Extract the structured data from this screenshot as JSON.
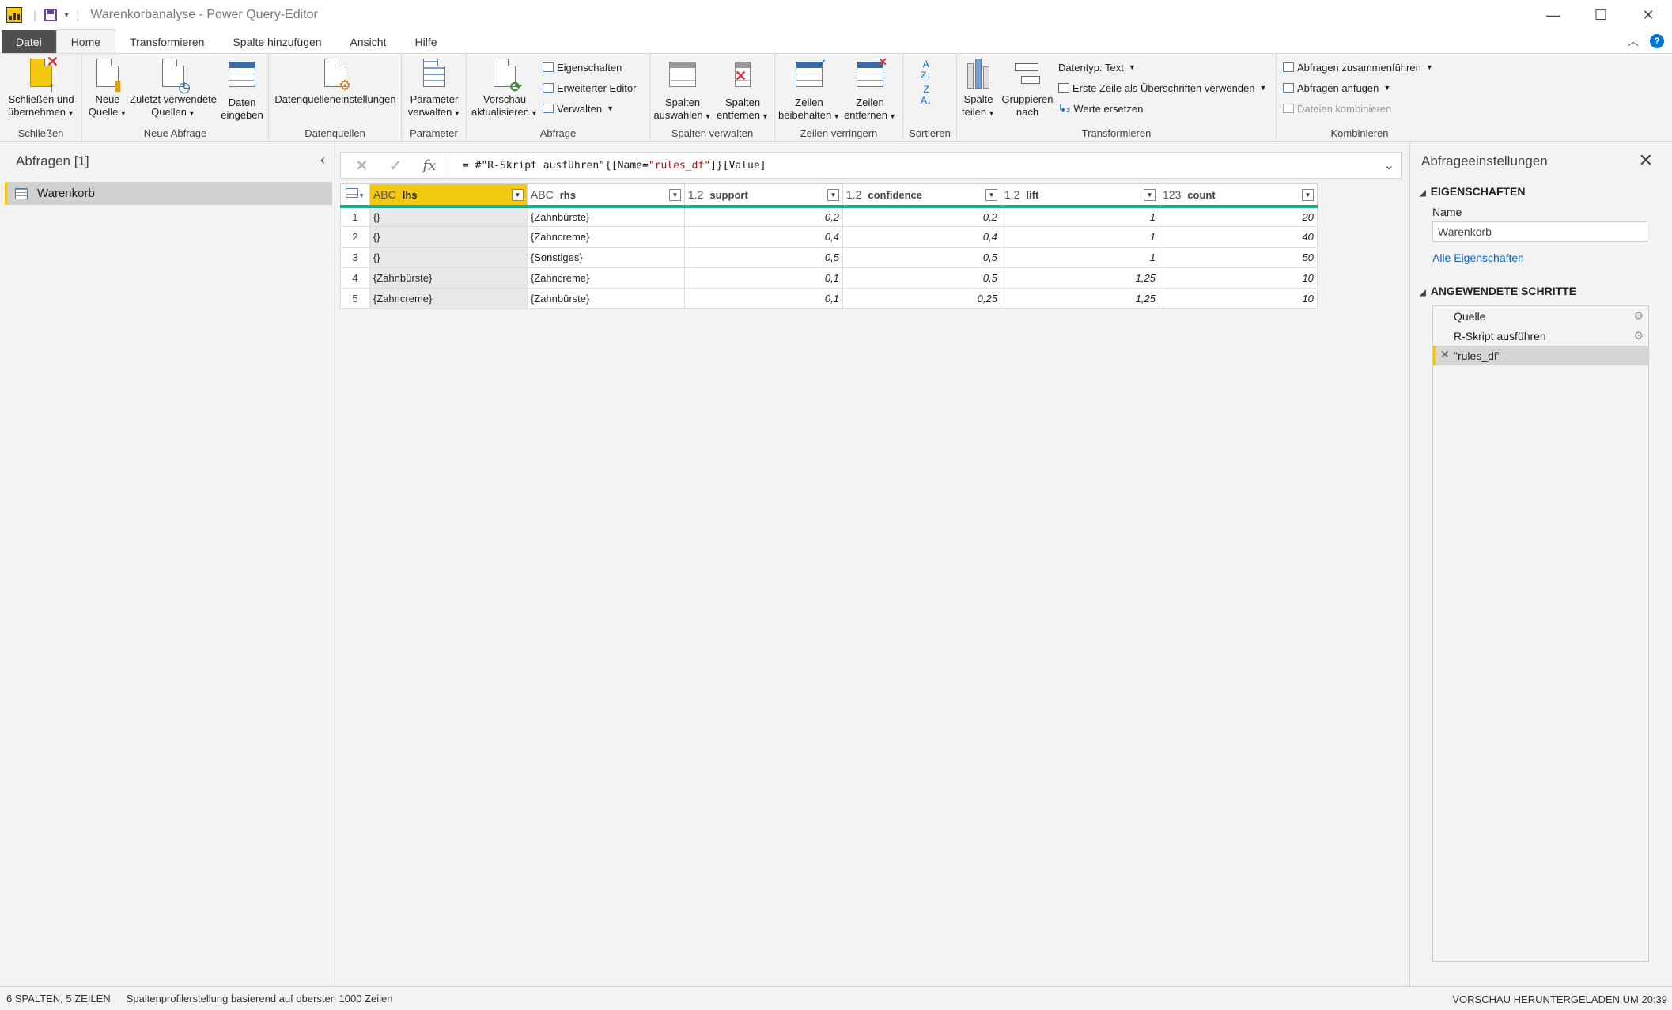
{
  "window": {
    "title": "Warenkorbanalyse - Power Query-Editor",
    "controls": {
      "minimize": "—",
      "maximize": "☐",
      "close": "✕"
    }
  },
  "tabs": [
    {
      "label": "Datei"
    },
    {
      "label": "Home"
    },
    {
      "label": "Transformieren"
    },
    {
      "label": "Spalte hinzufügen"
    },
    {
      "label": "Ansicht"
    },
    {
      "label": "Hilfe"
    }
  ],
  "help_label": "?",
  "ribbon": {
    "schliessen": {
      "btn1": "Schließen und",
      "btn2": "übernehmen",
      "group": "Schließen"
    },
    "neue_abfrage": {
      "neue_quelle_1": "Neue",
      "neue_quelle_2": "Quelle",
      "zuletzt_1": "Zuletzt verwendete",
      "zuletzt_2": "Quellen",
      "daten_1": "Daten",
      "daten_2": "eingeben",
      "group": "Neue Abfrage"
    },
    "datenquellen": {
      "btn": "Datenquelleneinstellungen",
      "group": "Datenquellen"
    },
    "parameter": {
      "btn1": "Parameter",
      "btn2": "verwalten",
      "group": "Parameter"
    },
    "abfrage": {
      "vorschau_1": "Vorschau",
      "vorschau_2": "aktualisieren",
      "eigenschaften": "Eigenschaften",
      "erweiterter_editor": "Erweiterter Editor",
      "verwalten": "Verwalten",
      "group": "Abfrage"
    },
    "spalten_verwalten": {
      "auswaehlen_1": "Spalten",
      "auswaehlen_2": "auswählen",
      "entfernen_1": "Spalten",
      "entfernen_2": "entfernen",
      "group": "Spalten verwalten"
    },
    "zeilen_verringern": {
      "beibehalten_1": "Zeilen",
      "beibehalten_2": "beibehalten",
      "entfernen_1": "Zeilen",
      "entfernen_2": "entfernen",
      "group": "Zeilen verringern"
    },
    "sortieren": {
      "group": "Sortieren"
    },
    "transformieren": {
      "teilen_1": "Spalte",
      "teilen_2": "teilen",
      "gruppieren_1": "Gruppieren",
      "gruppieren_2": "nach",
      "datentyp": "Datentyp: Text",
      "erste_zeile": "Erste Zeile als Überschriften verwenden",
      "werte_ersetzen": "Werte ersetzen",
      "group": "Transformieren"
    },
    "kombinieren": {
      "zusammenfuehren": "Abfragen zusammenführen",
      "anfuegen": "Abfragen anfügen",
      "dateien": "Dateien kombinieren",
      "group": "Kombinieren"
    }
  },
  "left_panel": {
    "title": "Abfragen [1]",
    "queries": [
      {
        "label": "Warenkorb"
      }
    ]
  },
  "formula": {
    "prefix": "= #\"R-Skript ausführen\"{[Name=",
    "string": "\"rules_df\"",
    "suffix": "]}[Value]"
  },
  "table": {
    "columns": [
      {
        "type": "ABC",
        "name": "lhs"
      },
      {
        "type": "ABC",
        "name": "rhs"
      },
      {
        "type": "1.2",
        "name": "support"
      },
      {
        "type": "1.2",
        "name": "confidence"
      },
      {
        "type": "1.2",
        "name": "lift"
      },
      {
        "type": "123",
        "name": "count"
      }
    ],
    "rows": [
      {
        "n": "1",
        "lhs": "{}",
        "rhs": "{Zahnbürste}",
        "support": "0,2",
        "confidence": "0,2",
        "lift": "1",
        "count": "20"
      },
      {
        "n": "2",
        "lhs": "{}",
        "rhs": "{Zahncreme}",
        "support": "0,4",
        "confidence": "0,4",
        "lift": "1",
        "count": "40"
      },
      {
        "n": "3",
        "lhs": "{}",
        "rhs": "{Sonstiges}",
        "support": "0,5",
        "confidence": "0,5",
        "lift": "1",
        "count": "50"
      },
      {
        "n": "4",
        "lhs": "{Zahnbürste}",
        "rhs": "{Zahncreme}",
        "support": "0,1",
        "confidence": "0,5",
        "lift": "1,25",
        "count": "10"
      },
      {
        "n": "5",
        "lhs": "{Zahncreme}",
        "rhs": "{Zahnbürste}",
        "support": "0,1",
        "confidence": "0,25",
        "lift": "1,25",
        "count": "10"
      }
    ]
  },
  "right_panel": {
    "title": "Abfrageeinstellungen",
    "eigenschaften": "EIGENSCHAFTEN",
    "name_label": "Name",
    "name_value": "Warenkorb",
    "all_props": "Alle Eigenschaften",
    "steps_title": "ANGEWENDETE SCHRITTE",
    "steps": [
      {
        "label": "Quelle"
      },
      {
        "label": "R-Skript ausführen"
      },
      {
        "label": "\"rules_df\""
      }
    ]
  },
  "status": {
    "left": "6 SPALTEN, 5 ZEILEN",
    "profile": "Spaltenprofilerstellung basierend auf obersten 1000 Zeilen",
    "right": "VORSCHAU HERUNTERGELADEN UM 20:39"
  },
  "colors": {
    "accent": "#f2c811",
    "header_bar": "#1fab89",
    "link": "#0a64c0"
  }
}
